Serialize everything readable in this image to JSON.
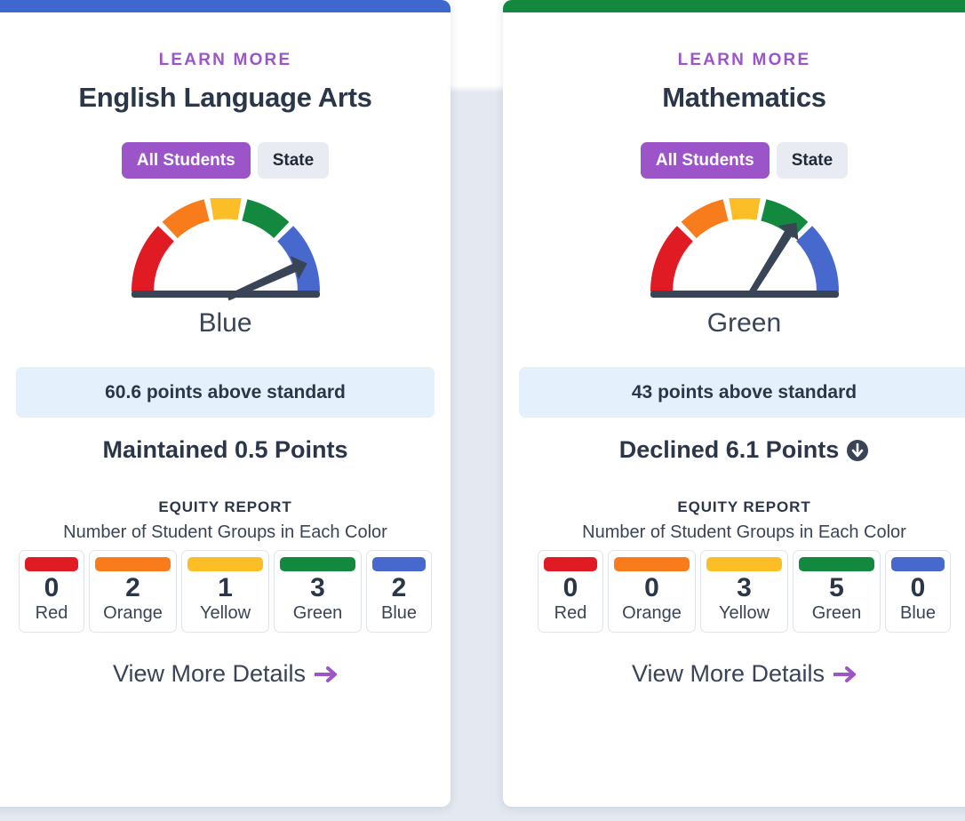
{
  "page": {
    "background_color": "#e4e8f0",
    "accent_purple": "#9b55c9",
    "text_dark": "#2b3648"
  },
  "cards": [
    {
      "id": "english-language-arts",
      "top_bar_color": "#3f68ce",
      "eyebrow": "LEARN MORE",
      "title": "English Language Arts",
      "toggle": {
        "active_label": "All Students",
        "inactive_label": "State"
      },
      "gauge": {
        "colors": [
          "#e01b24",
          "#f97c1c",
          "#fcbe26",
          "#13893f",
          "#4769ce"
        ],
        "needle_angle_deg": 19,
        "needle_color": "#3a4457",
        "baseline_color": "#3a4457"
      },
      "gauge_label": "Blue",
      "status_banner": "60.6 points above standard",
      "change_text": "Maintained 0.5 Points",
      "change_icon": "",
      "equity": {
        "heading": "EQUITY REPORT",
        "subheading": "Number of Student Groups in Each Color",
        "groups": [
          {
            "count": "0",
            "label": "Red",
            "color": "#e01b24"
          },
          {
            "count": "2",
            "label": "Orange",
            "color": "#f97c1c"
          },
          {
            "count": "1",
            "label": "Yellow",
            "color": "#fcbe26"
          },
          {
            "count": "3",
            "label": "Green",
            "color": "#13893f"
          },
          {
            "count": "2",
            "label": "Blue",
            "color": "#4769ce"
          }
        ]
      },
      "details_link": "View More Details"
    },
    {
      "id": "mathematics",
      "top_bar_color": "#13893f",
      "eyebrow": "LEARN MORE",
      "title": "Mathematics",
      "toggle": {
        "active_label": "All Students",
        "inactive_label": "State"
      },
      "gauge": {
        "colors": [
          "#e01b24",
          "#f97c1c",
          "#fcbe26",
          "#13893f",
          "#4769ce"
        ],
        "needle_angle_deg": 53,
        "needle_color": "#3a4457",
        "baseline_color": "#3a4457"
      },
      "gauge_label": "Green",
      "status_banner": "43 points above standard",
      "change_text": "Declined 6.1 Points",
      "change_icon": "arrow-down-circle-icon",
      "equity": {
        "heading": "EQUITY REPORT",
        "subheading": "Number of Student Groups in Each Color",
        "groups": [
          {
            "count": "0",
            "label": "Red",
            "color": "#e01b24"
          },
          {
            "count": "0",
            "label": "Orange",
            "color": "#f97c1c"
          },
          {
            "count": "3",
            "label": "Yellow",
            "color": "#fcbe26"
          },
          {
            "count": "5",
            "label": "Green",
            "color": "#13893f"
          },
          {
            "count": "0",
            "label": "Blue",
            "color": "#4769ce"
          }
        ]
      },
      "details_link": "View More Details"
    }
  ]
}
